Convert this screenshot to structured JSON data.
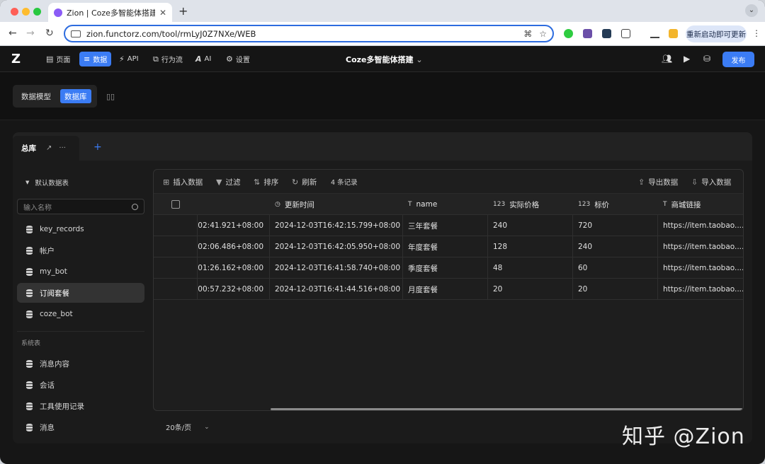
{
  "browser": {
    "tab_title": "Zion | Coze多智能体搭建",
    "url": "zion.functorz.com/tool/rmLyJ0Z7NXe/WEB",
    "update_button": "重新启动即可更新"
  },
  "app": {
    "nav": [
      {
        "label": "页面"
      },
      {
        "label": "数据"
      },
      {
        "label": "API"
      },
      {
        "label": "行为流"
      },
      {
        "label": "AI"
      },
      {
        "label": "设置"
      }
    ],
    "project_title": "Coze多智能体搭建",
    "publish_label": "发布"
  },
  "subbar": {
    "data_model": "数据模型",
    "database": "数据库"
  },
  "main": {
    "tab_label": "总库",
    "sidebar": {
      "group_title": "默认数据表",
      "search_placeholder": "输入名称",
      "tables": [
        {
          "label": "key_records"
        },
        {
          "label": "帐户"
        },
        {
          "label": "my_bot"
        },
        {
          "label": "订阅套餐"
        },
        {
          "label": "coze_bot"
        }
      ],
      "system_title": "系统表",
      "system_tables": [
        {
          "label": "消息内容"
        },
        {
          "label": "会话"
        },
        {
          "label": "工具使用记录"
        },
        {
          "label": "消息"
        }
      ]
    },
    "toolbar": {
      "insert": "插入数据",
      "filter": "过滤",
      "sort": "排序",
      "refresh": "刷新",
      "count": "4 条记录",
      "export": "导出数据",
      "import": "导入数据"
    },
    "columns": {
      "updated": "更新时间",
      "name": "name",
      "actual_price": "实际价格",
      "list_price": "标价",
      "link": "商城链接"
    },
    "rows": [
      {
        "created": ":02:41.921+08:00",
        "updated": "2024-12-03T16:42:15.799+08:00",
        "name": "三年套餐",
        "actual_price": "240",
        "list_price": "720",
        "link": "https://item.taobao...."
      },
      {
        "created": ":02:06.486+08:00",
        "updated": "2024-12-03T16:42:05.950+08:00",
        "name": "年度套餐",
        "actual_price": "128",
        "list_price": "240",
        "link": "https://item.taobao...."
      },
      {
        "created": ":01:26.162+08:00",
        "updated": "2024-12-03T16:41:58.740+08:00",
        "name": "季度套餐",
        "actual_price": "48",
        "list_price": "60",
        "link": "https://item.taobao...."
      },
      {
        "created": ":00:57.232+08:00",
        "updated": "2024-12-03T16:41:44.516+08:00",
        "name": "月度套餐",
        "actual_price": "20",
        "list_price": "20",
        "link": "https://item.taobao...."
      }
    ],
    "pager": "20条/页"
  },
  "watermark": "知乎 @Zion"
}
